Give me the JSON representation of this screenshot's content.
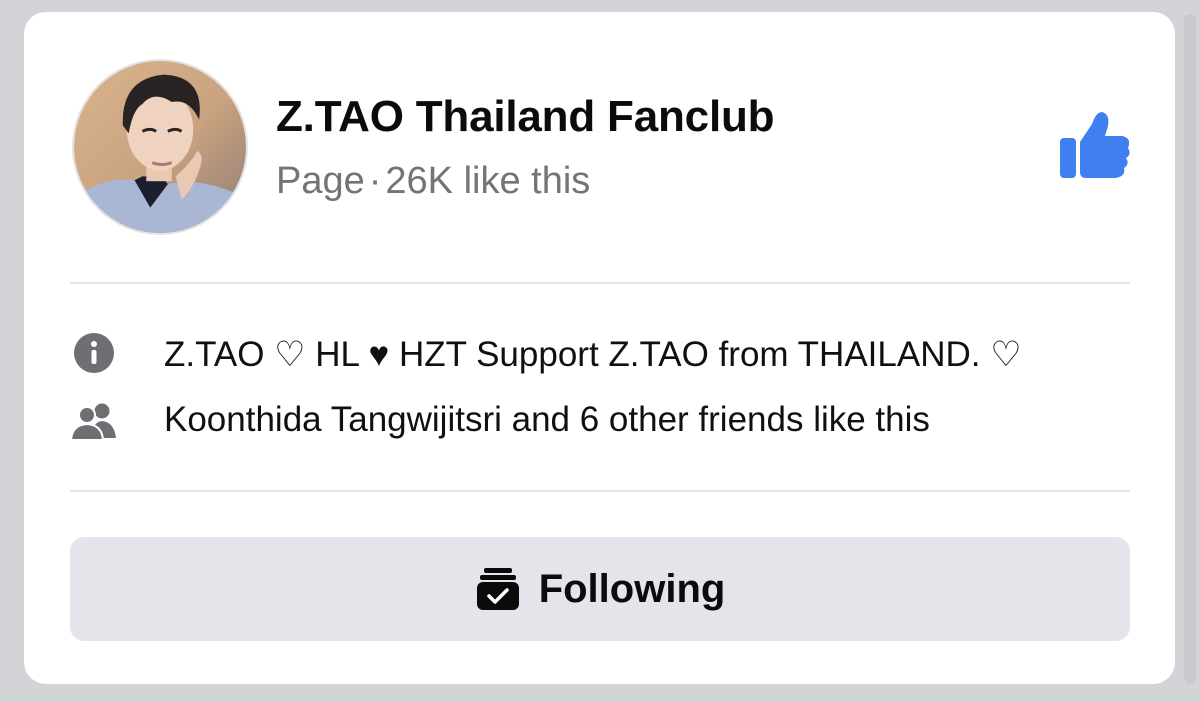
{
  "page": {
    "name": "Z.TAO Thailand Fanclub",
    "type_label": "Page",
    "separator": "·",
    "likes_text": "26K like this"
  },
  "about": {
    "description": "Z.TAO ♡ HL ♥ HZT Support Z.TAO from THAILAND. ♡",
    "friends_text": "Koonthida Tangwijitsri and 6 other friends like this"
  },
  "follow_button": {
    "label": "Following"
  },
  "icons": {
    "like": "thumbs-up-icon",
    "info": "info-icon",
    "friends": "friends-icon",
    "following": "following-check-icon"
  },
  "colors": {
    "accent": "#3f7ff0",
    "card_bg": "#ffffff",
    "page_bg": "#d3d4d8",
    "button_bg": "#e4e5ea",
    "muted_text": "#737378"
  }
}
